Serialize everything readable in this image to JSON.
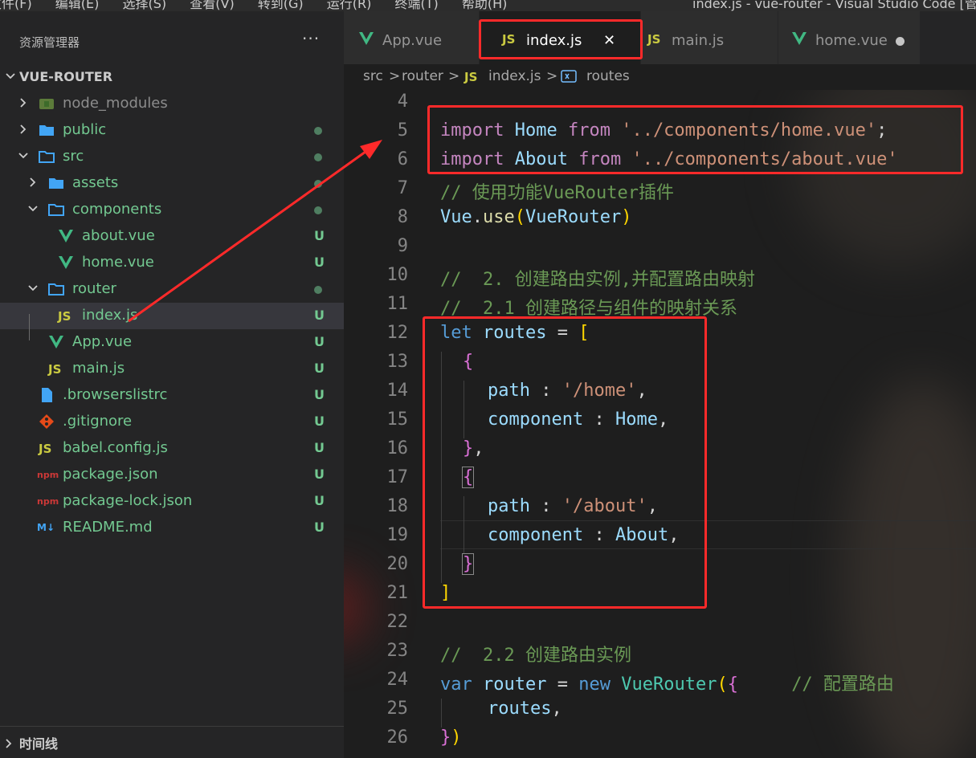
{
  "menubar": {
    "items": [
      "文件(F)",
      "编辑(E)",
      "选择(S)",
      "查看(V)",
      "转到(G)",
      "运行(R)",
      "终端(T)",
      "帮助(H)"
    ],
    "window_title": "index.js - vue-router - Visual Studio Code [管"
  },
  "sidebar": {
    "title": "资源管理器",
    "more": "···",
    "root": "VUE-ROUTER",
    "items": [
      {
        "label": "node_modules",
        "badge": ""
      },
      {
        "label": "public",
        "badge": "dot"
      },
      {
        "label": "src",
        "badge": "dot"
      },
      {
        "label": "assets",
        "badge": "dot"
      },
      {
        "label": "components",
        "badge": "dot"
      },
      {
        "label": "about.vue",
        "badge": "U"
      },
      {
        "label": "home.vue",
        "badge": "U"
      },
      {
        "label": "router",
        "badge": "dot"
      },
      {
        "label": "index.js",
        "badge": "U"
      },
      {
        "label": "App.vue",
        "badge": "U"
      },
      {
        "label": "main.js",
        "badge": "U"
      },
      {
        "label": ".browserslistrc",
        "badge": "U"
      },
      {
        "label": ".gitignore",
        "badge": "U"
      },
      {
        "label": "babel.config.js",
        "badge": "U"
      },
      {
        "label": "package.json",
        "badge": "U"
      },
      {
        "label": "package-lock.json",
        "badge": "U"
      },
      {
        "label": "README.md",
        "badge": "U"
      }
    ],
    "timeline": "时间线"
  },
  "tabs": [
    {
      "label": "App.vue"
    },
    {
      "label": "index.js",
      "close": "✕"
    },
    {
      "label": "main.js"
    },
    {
      "label": "home.vue"
    }
  ],
  "breadcrumb": [
    "src",
    ">",
    "router",
    ">",
    "index.js",
    ">",
    "routes"
  ],
  "icons": {
    "js_glyph": "JS",
    "md_glyph": "M↓",
    "npm_glyph": "npm"
  },
  "editor": {
    "line_numbers": [
      "4",
      "5",
      "6",
      "7",
      "8",
      "9",
      "10",
      "11",
      "12",
      "13",
      "14",
      "15",
      "16",
      "17",
      "18",
      "19",
      "20",
      "21",
      "22",
      "23",
      "24",
      "25",
      "26"
    ],
    "l5": {
      "kw": "import",
      "id": "Home",
      "from": "from",
      "str": "'../components/home.vue'",
      "end": ";"
    },
    "l6": {
      "kw": "import",
      "id": "About",
      "from": "from",
      "str": "'../components/about.vue'"
    },
    "l7": "// 使用功能VueRouter插件",
    "l8": {
      "obj": "Vue",
      "dot": ".",
      "fn": "use",
      "open": "(",
      "cls": "VueRouter",
      "close": ")"
    },
    "l10": "//  2. 创建路由实例,并配置路由映射",
    "l11": "//  2.1 创建路径与组件的映射关系",
    "l12": {
      "kw": "let",
      "id": "routes",
      "eq": " = ",
      "br": "["
    },
    "l13": "{",
    "l14": {
      "key": "path",
      "colon": " : ",
      "str": "'/home'",
      "end": ","
    },
    "l15": {
      "key": "component",
      "colon": " : ",
      "id": "Home",
      "end": ","
    },
    "l16": {
      "br": "}",
      "end": ","
    },
    "l17": "{",
    "l18": {
      "key": "path",
      "colon": " : ",
      "str": "'/about'",
      "end": ","
    },
    "l19": {
      "key": "component",
      "colon": " : ",
      "id": "About",
      "end": ","
    },
    "l20": "}",
    "l21": "]",
    "l23": "//  2.2 创建路由实例",
    "l24": {
      "kw": "var",
      "id": "router",
      "eq": " = ",
      "new": "new",
      "cls": "VueRouter",
      "open": "(",
      "br": "{",
      "cm": "// 配置路由"
    },
    "l25": {
      "id": "routes",
      "end": ","
    },
    "l26": {
      "br": "}",
      "close": ")"
    }
  }
}
